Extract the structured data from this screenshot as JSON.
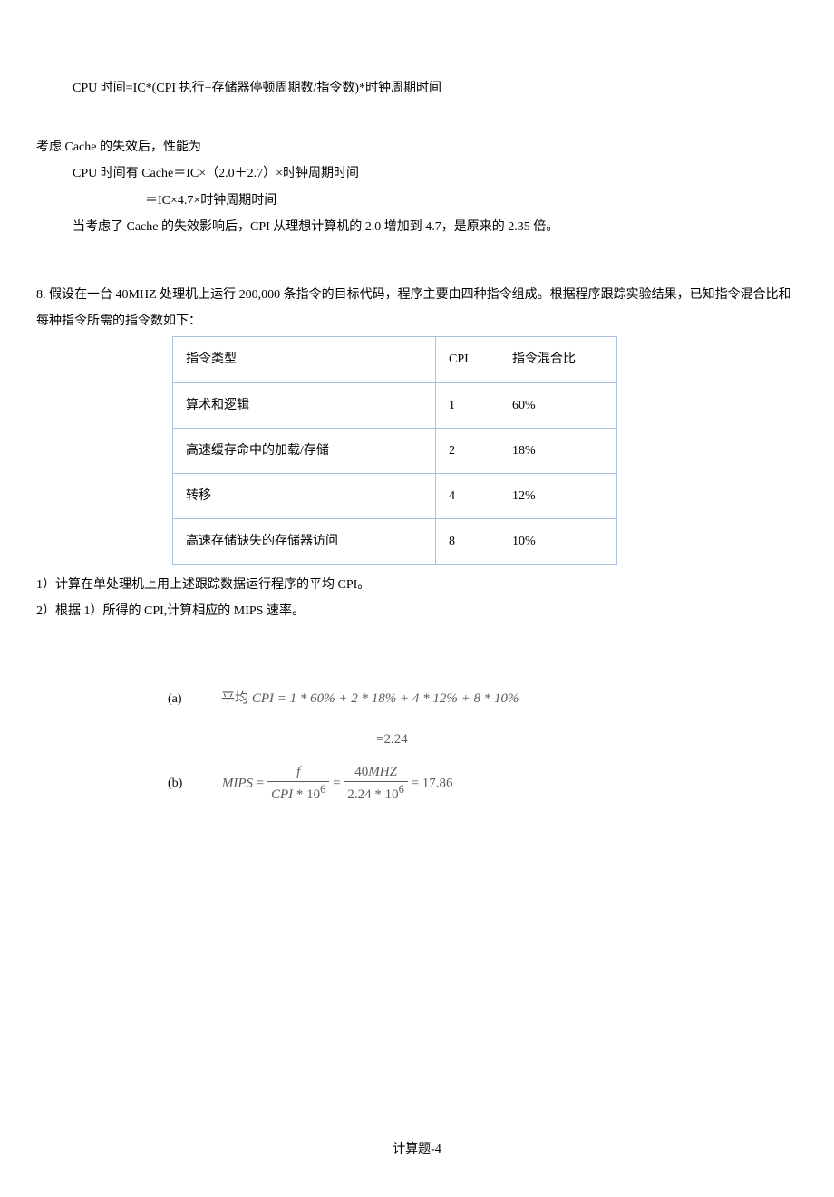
{
  "top": {
    "line1": "CPU 时间=IC*(CPI 执行+存储器停顿周期数/指令数)*时钟周期时间",
    "line2": "考虑 Cache 的失效后，性能为",
    "line3": "CPU 时间有 Cache＝IC×（2.0＋2.7）×时钟周期时间",
    "line4": "＝IC×4.7×时钟周期时间",
    "line5": "当考虑了 Cache 的失效影响后，CPI 从理想计算机的 2.0 增加到 4.7，是原来的 2.35 倍。"
  },
  "q8": {
    "stem1": "8. 假设在一台 40MHZ 处理机上运行 200,000 条指令的目标代码，程序主要由四种指令组成。根据程序跟踪实验结果，已知指令混合比和",
    "stem2": "每种指令所需的指令数如下：",
    "table": {
      "headers": [
        "指令类型",
        "CPI",
        "指令混合比"
      ],
      "rows": [
        [
          "算术和逻辑",
          "1",
          "60%"
        ],
        [
          "高速缓存命中的加载/存储",
          "2",
          "18%"
        ],
        [
          "转移",
          "4",
          "12%"
        ],
        [
          "高速存储缺失的存储器访问",
          "8",
          "10%"
        ]
      ]
    },
    "sub1": "1）计算在单处理机上用上述跟踪数据运行程序的平均 CPI。",
    "sub2": "2）根据 1）所得的 CPI,计算相应的 MIPS 速率。"
  },
  "answers": {
    "a_label": "(a)",
    "a_line1_prefix": "平均 ",
    "a_line1_formula": "CPI = 1 * 60% + 2 * 18% + 4 * 12% + 8 * 10%",
    "a_line2": "=2.24",
    "b_label": "(b)",
    "b_mips": "MIPS",
    "b_eq": " = ",
    "b_frac1_num": "f",
    "b_frac1_den_a": "CPI",
    "b_frac1_den_b": " * 10",
    "b_frac1_den_exp": "6",
    "b_mid": " = ",
    "b_frac2_num_a": "40",
    "b_frac2_num_b": "MHZ",
    "b_frac2_den_a": "2.24 * 10",
    "b_frac2_den_exp": "6",
    "b_result": " = 17.86"
  },
  "footer": "计算题-4"
}
